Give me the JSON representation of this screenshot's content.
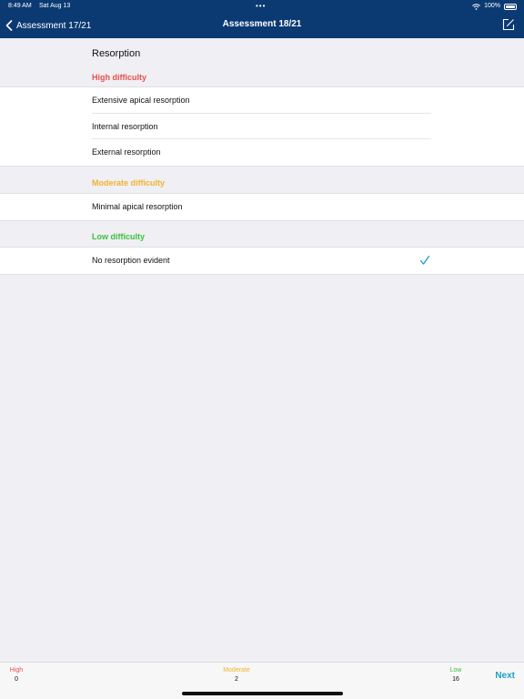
{
  "status_bar": {
    "time": "8:49 AM",
    "date": "Sat Aug 13",
    "battery": "100%"
  },
  "nav": {
    "back_label": "Assessment 17/21",
    "title": "Assessment 18/21"
  },
  "section_title": "Resorption",
  "colors": {
    "nav_bg": "#0b3a73",
    "high": "#e8504b",
    "moderate": "#f0b42c",
    "low": "#3cc03c",
    "accent": "#1aa0c8"
  },
  "groups": [
    {
      "header": "High difficulty",
      "items": [
        {
          "label": "Extensive apical resorption",
          "selected": false
        },
        {
          "label": "Internal resorption",
          "selected": false
        },
        {
          "label": "External resorption",
          "selected": false
        }
      ]
    },
    {
      "header": "Moderate difficulty",
      "items": [
        {
          "label": "Minimal apical resorption",
          "selected": false
        }
      ]
    },
    {
      "header": "Low difficulty",
      "items": [
        {
          "label": "No resorption evident",
          "selected": true
        }
      ]
    }
  ],
  "bottom_bar": {
    "high": {
      "label": "High",
      "value": "0"
    },
    "moderate": {
      "label": "Moderate",
      "value": "2"
    },
    "low": {
      "label": "Low",
      "value": "16"
    },
    "next_label": "Next"
  },
  "icons": {
    "back": "chevron-left-icon",
    "edit": "edit-note-icon",
    "check": "checkmark-icon",
    "wifi": "wifi-icon",
    "battery": "battery-icon"
  }
}
